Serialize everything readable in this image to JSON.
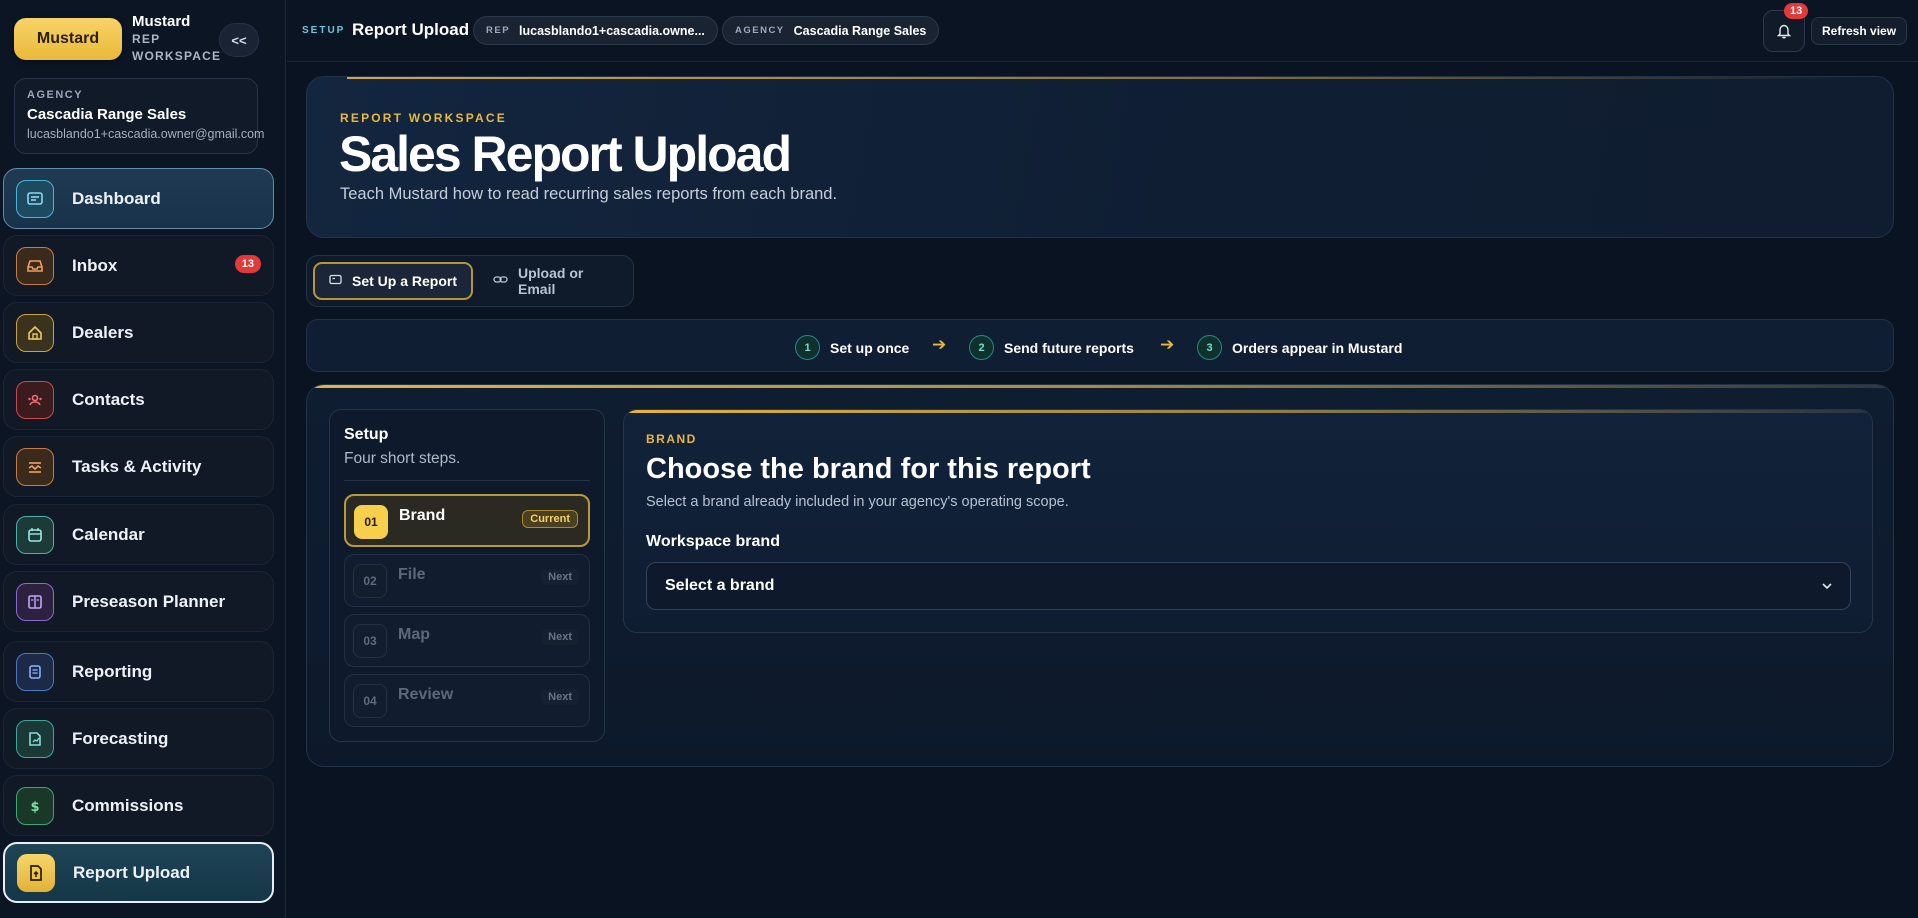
{
  "app": {
    "brand_button": "Mustard",
    "brand_name": "Mustard",
    "brand_sub": "REP\nWORKSPACE",
    "collapse_label": "<<"
  },
  "agency": {
    "label": "AGENCY",
    "name": "Cascadia Range Sales",
    "email": "lucasblando1+cascadia.owner@gmail.com"
  },
  "sidebar": {
    "items": [
      {
        "label": "Dashboard",
        "icon": "dashboard-icon",
        "color": "#4fb3d9"
      },
      {
        "label": "Inbox",
        "icon": "inbox-icon",
        "color": "#e08a4a",
        "badge": "13"
      },
      {
        "label": "Dealers",
        "icon": "home-icon",
        "color": "#d9b44a"
      },
      {
        "label": "Contacts",
        "icon": "contacts-icon",
        "color": "#e05a5a"
      },
      {
        "label": "Tasks & Activity",
        "icon": "tasks-icon",
        "color": "#e08a4a"
      },
      {
        "label": "Calendar",
        "icon": "calendar-icon",
        "color": "#5ac8c0"
      },
      {
        "label": "Preseason Planner",
        "icon": "planner-icon",
        "color": "#9a7ae0"
      },
      {
        "label": "Reporting",
        "icon": "reporting-icon",
        "color": "#5a8ae0"
      },
      {
        "label": "Forecasting",
        "icon": "forecast-icon",
        "color": "#3ac0b0"
      },
      {
        "label": "Commissions",
        "icon": "dollar-icon",
        "color": "#3ac080"
      },
      {
        "label": "Report Upload",
        "icon": "upload-report-icon",
        "color": "#f0c850"
      }
    ]
  },
  "topbar": {
    "crumb_tag": "SETUP",
    "crumb_title": "Report Upload",
    "rep_tag": "REP",
    "rep_value": "lucasblando1+cascadia.owne...",
    "agency_tag": "AGENCY",
    "agency_value": "Cascadia Range Sales",
    "notification_count": "13",
    "refresh_label": "Refresh view"
  },
  "hero": {
    "eyebrow": "REPORT WORKSPACE",
    "title": "Sales Report Upload",
    "subtitle": "Teach Mustard how to read recurring sales reports from each brand."
  },
  "tabs": [
    {
      "label": "Set Up a Report",
      "active": true
    },
    {
      "label": "Upload or Email",
      "active": false
    }
  ],
  "flow_steps": [
    {
      "num": "1",
      "label": "Set up once"
    },
    {
      "num": "2",
      "label": "Send future reports"
    },
    {
      "num": "3",
      "label": "Orders appear in Mustard"
    }
  ],
  "setup": {
    "title": "Setup",
    "subtitle": "Four short steps.",
    "steps": [
      {
        "num": "01",
        "label": "Brand",
        "tag": "Current"
      },
      {
        "num": "02",
        "label": "File",
        "tag": "Next"
      },
      {
        "num": "03",
        "label": "Map",
        "tag": "Next"
      },
      {
        "num": "04",
        "label": "Review",
        "tag": "Next"
      }
    ]
  },
  "brand_step": {
    "eyebrow": "BRAND",
    "title": "Choose the brand for this report",
    "subtitle": "Select a brand already included in your agency's operating scope.",
    "field_label": "Workspace brand",
    "select_value": "Select a brand"
  },
  "colors": {
    "accent": "#f6cf4d",
    "background": "#0a1322",
    "badge": "#e23a3a"
  }
}
